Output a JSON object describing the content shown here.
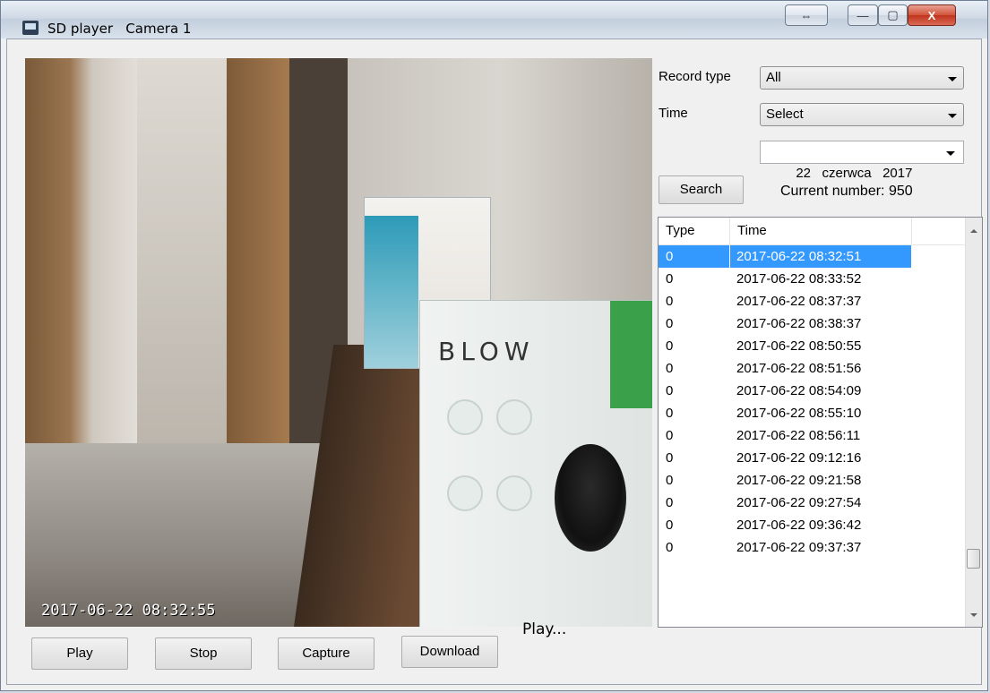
{
  "window": {
    "title": "SD player   Camera 1",
    "controls": {
      "restore": "⇔",
      "minimize": "—",
      "maximize": "▢",
      "close": "X"
    }
  },
  "video": {
    "timestamp": "2017-06-22  08:32:55",
    "box_brand": "BLOW"
  },
  "filters": {
    "record_type_label": "Record type",
    "record_type_value": "All",
    "time_label": "Time",
    "time_value": "Select",
    "date_day": "22",
    "date_month": "czerwca",
    "date_year": "2017"
  },
  "search": {
    "button_label": "Search",
    "current_number_label": "Current number: 950"
  },
  "records": {
    "columns": [
      "Type",
      "Time"
    ],
    "selected_index": 0,
    "rows": [
      {
        "type": "0",
        "time": "2017-06-22 08:32:51"
      },
      {
        "type": "0",
        "time": "2017-06-22 08:33:52"
      },
      {
        "type": "0",
        "time": "2017-06-22 08:37:37"
      },
      {
        "type": "0",
        "time": "2017-06-22 08:38:37"
      },
      {
        "type": "0",
        "time": "2017-06-22 08:50:55"
      },
      {
        "type": "0",
        "time": "2017-06-22 08:51:56"
      },
      {
        "type": "0",
        "time": "2017-06-22 08:54:09"
      },
      {
        "type": "0",
        "time": "2017-06-22 08:55:10"
      },
      {
        "type": "0",
        "time": "2017-06-22 08:56:11"
      },
      {
        "type": "0",
        "time": "2017-06-22 09:12:16"
      },
      {
        "type": "0",
        "time": "2017-06-22 09:21:58"
      },
      {
        "type": "0",
        "time": "2017-06-22 09:27:54"
      },
      {
        "type": "0",
        "time": "2017-06-22 09:36:42"
      },
      {
        "type": "0",
        "time": "2017-06-22 09:37:37"
      }
    ]
  },
  "toolbar": {
    "play_label": "Play",
    "stop_label": "Stop",
    "capture_label": "Capture",
    "download_label": "Download",
    "status_text": "Play..."
  }
}
